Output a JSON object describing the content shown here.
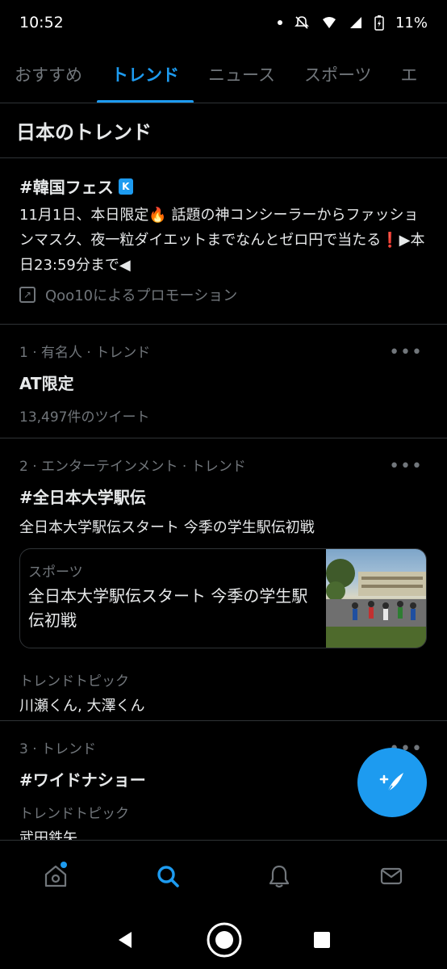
{
  "status_bar": {
    "time": "10:52",
    "battery": "11%"
  },
  "tabs": [
    {
      "label": "おすすめ"
    },
    {
      "label": "トレンド"
    },
    {
      "label": "ニュース"
    },
    {
      "label": "スポーツ"
    },
    {
      "label": "エ"
    }
  ],
  "section_title": "日本のトレンド",
  "promo": {
    "title": "#韓国フェス",
    "badge": "K",
    "description": "11月1日、本日限定🔥 話題の神コンシーラーからファッションマスク、夜一粒ダイエットまでなんとゼロ円で当たる❗▶本日23:59分まで◀",
    "promoted_by": "Qoo10によるプロモーション"
  },
  "trends": [
    {
      "meta": "1 · 有名人 · トレンド",
      "name": "AT限定",
      "count": "13,497件のツイート"
    },
    {
      "meta": "2 · エンターテインメント · トレンド",
      "name": "#全日本大学駅伝",
      "subtitle": "全日本大学駅伝スタート 今季の学生駅伝初戦",
      "card": {
        "category": "スポーツ",
        "headline": "全日本大学駅伝スタート 今季の学生駅伝初戦"
      },
      "topic_label": "トレンドトピック",
      "topic_value": "川瀬くん, 大澤くん"
    },
    {
      "meta": "3 · トレンド",
      "name": "#ワイドナショー",
      "topic_label": "トレンドトピック",
      "topic_value": "武田鉄矢"
    }
  ],
  "more_label": "•••",
  "colors": {
    "accent": "#1d9bf0",
    "background": "#000000",
    "secondary_text": "#71767b",
    "divider": "#2f3336"
  }
}
